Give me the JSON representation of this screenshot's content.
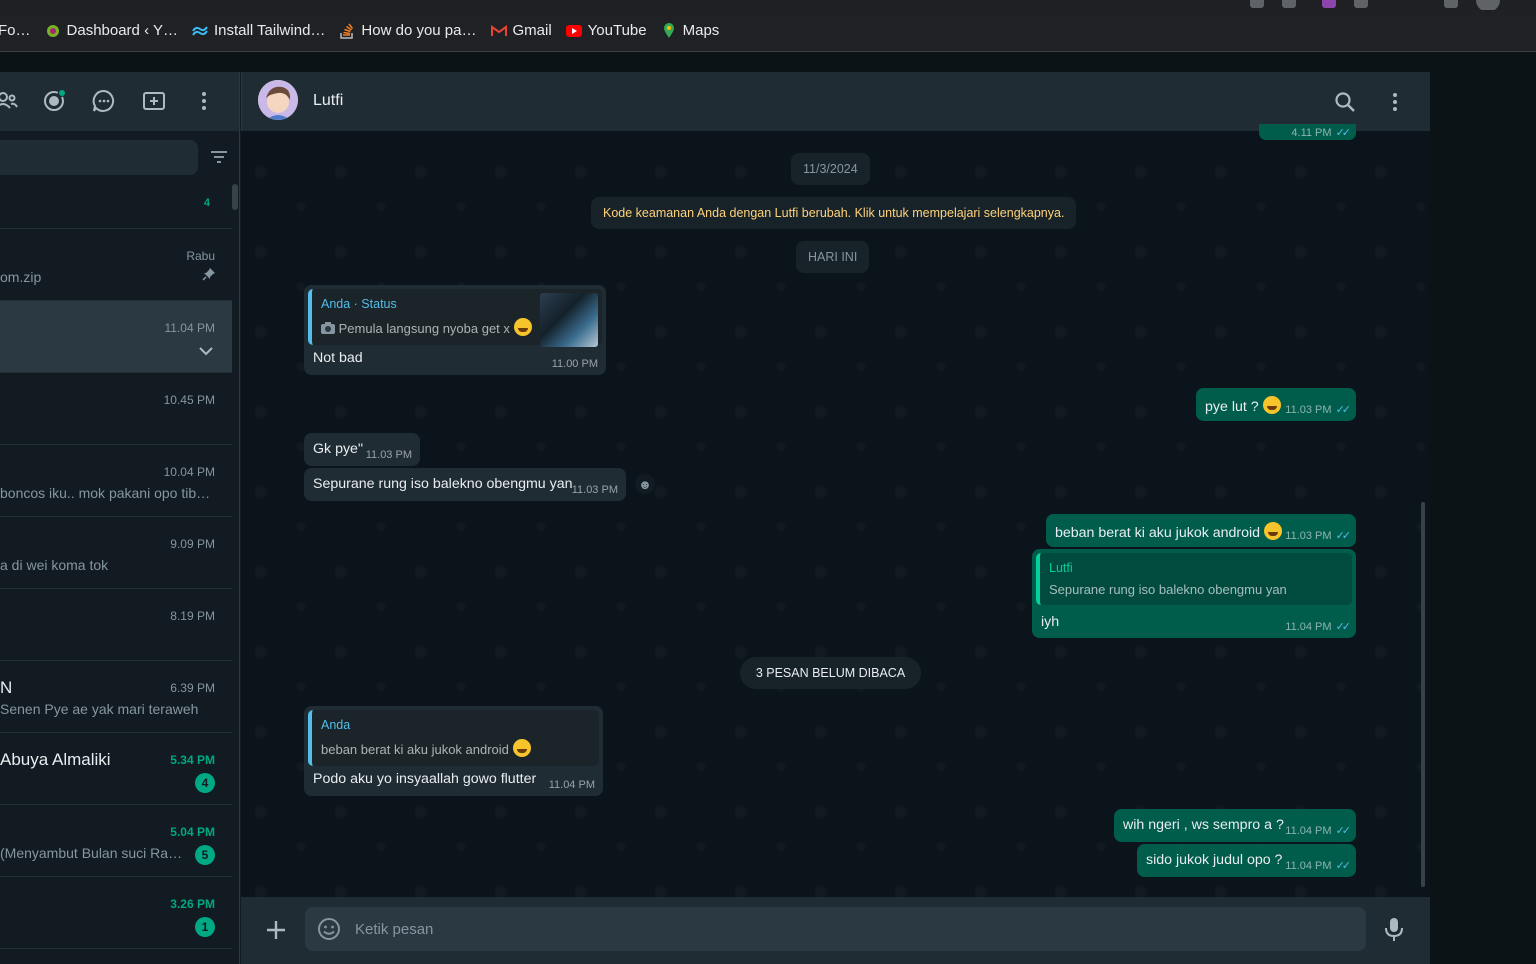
{
  "browser": {
    "bookmarks": [
      {
        "label": "Fo…",
        "icon": "none"
      },
      {
        "label": "Dashboard ‹ Y…",
        "icon": "yoast-icon"
      },
      {
        "label": "Install Tailwind…",
        "icon": "tailwind-icon"
      },
      {
        "label": "How do you pa…",
        "icon": "stackoverflow-icon"
      },
      {
        "label": "Gmail",
        "icon": "gmail-icon"
      },
      {
        "label": "YouTube",
        "icon": "youtube-icon"
      },
      {
        "label": "Maps",
        "icon": "maps-icon"
      }
    ]
  },
  "sidebar": {
    "header_icons": [
      "community-icon",
      "status-icon",
      "channels-icon",
      "new-chat-icon",
      "menu-icon"
    ],
    "chats": [
      {
        "name": "",
        "preview": "",
        "time": "",
        "count": "4"
      },
      {
        "name": "",
        "preview": "om.zip",
        "time": "Rabu",
        "pinned": true
      },
      {
        "name": "",
        "preview": "",
        "time": "11.04 PM",
        "selected": true
      },
      {
        "name": "",
        "preview": "",
        "time": "10.45 PM"
      },
      {
        "name": "",
        "preview": "boncos iku.. mok pakani opo tib…",
        "time": "10.04 PM"
      },
      {
        "name": "",
        "preview": "a di wei koma tok",
        "time": "9.09 PM"
      },
      {
        "name": "",
        "preview": "",
        "time": "8.19 PM"
      },
      {
        "name": "N",
        "preview": "Senen Pye ae yak mari teraweh",
        "time": "6.39 PM"
      },
      {
        "name": "Abuya Almaliki",
        "preview": "",
        "time": "5.34 PM",
        "badge": "4"
      },
      {
        "name": "",
        "preview": "(Menyambut Bulan suci Ra…",
        "time": "5.04 PM",
        "badge": "5"
      },
      {
        "name": "",
        "preview": "",
        "time": "3.26 PM",
        "badge": "1"
      }
    ]
  },
  "conversation": {
    "contact_name": "Lutfi",
    "top_partial_time": "4.11 PM",
    "date_pill": "11/3/2024",
    "security_notice": "Kode keamanan Anda dengan Lutfi berubah. Klik untuk mempelajari selengkapnya.",
    "today_pill": "HARI INI",
    "unread_pill": "3 PESAN BELUM DIBACA",
    "messages": {
      "m1": {
        "quote_name": "Anda · Status",
        "quote_text": "Pemula langsung nyoba get x",
        "text": "Not bad",
        "time": "11.00 PM"
      },
      "m2": {
        "text": "pye lut ?",
        "time": "11.03 PM"
      },
      "m3": {
        "text": "Gk pye\"",
        "time": "11.03 PM"
      },
      "m4": {
        "text": "Sepurane rung iso balekno obengmu yan",
        "time": "11.03 PM"
      },
      "m5": {
        "text": "beban berat ki aku jukok android",
        "time": "11.03 PM"
      },
      "m6": {
        "quote_name": "Lutfi",
        "quote_text": "Sepurane rung iso balekno obengmu yan",
        "text": "iyh",
        "time": "11.04 PM"
      },
      "m7": {
        "quote_name": "Anda",
        "quote_text": "beban berat ki aku jukok android",
        "text": "Podo aku yo insyaallah gowo flutter",
        "time": "11.04 PM"
      },
      "m8": {
        "text": "wih ngeri , ws sempro a ?",
        "time": "11.04 PM"
      },
      "m9": {
        "text": "sido jukok judul opo ?",
        "time": "11.04 PM"
      }
    },
    "input_placeholder": "Ketik pesan"
  },
  "colors": {
    "accent": "#00a884",
    "outgoing": "#005c4b",
    "incoming": "#202c33",
    "ticks": "#53bdeb",
    "notice": "#ffd279"
  }
}
